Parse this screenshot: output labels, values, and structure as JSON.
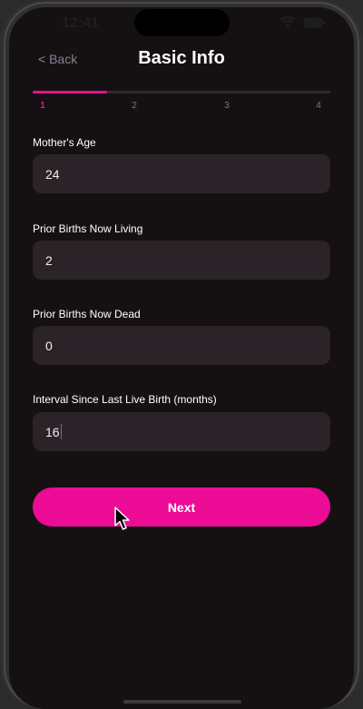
{
  "status_bar": {
    "time": "12:41"
  },
  "nav": {
    "back_label": "< Back",
    "title": "Basic Info"
  },
  "progress": {
    "steps": [
      "1",
      "2",
      "3",
      "4"
    ],
    "active_step": 1,
    "fill_fraction": 0.25,
    "accent_color": "#ec0c96"
  },
  "form": {
    "fields": [
      {
        "label": "Mother's Age",
        "value": "24"
      },
      {
        "label": "Prior Births Now Living",
        "value": "2"
      },
      {
        "label": "Prior Births Now Dead",
        "value": "0"
      },
      {
        "label": "Interval Since Last Live Birth (months)",
        "value": "16"
      }
    ]
  },
  "next_button": {
    "label": "Next"
  }
}
